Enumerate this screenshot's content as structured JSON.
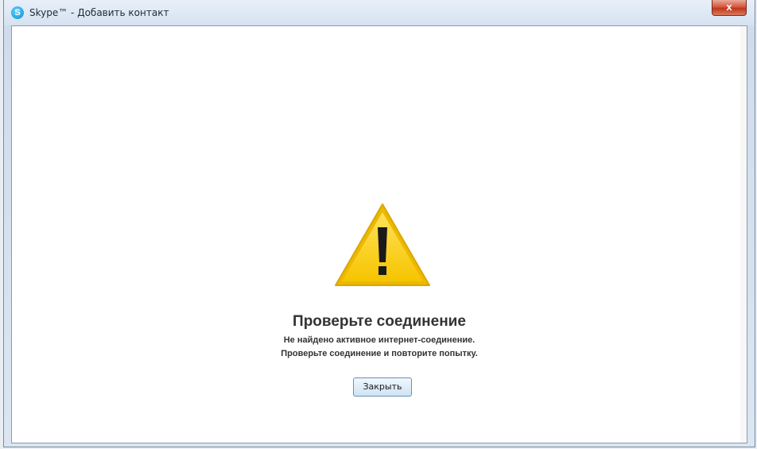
{
  "window": {
    "title": "Skype™ - Добавить контакт",
    "icon": "skype-icon",
    "close_label": "x"
  },
  "message": {
    "icon": "warning-triangle-icon",
    "title": "Проверьте соединение",
    "line1": "Не найдено активное интернет-соединение.",
    "line2": "Проверьте соединение и повторите попытку."
  },
  "actions": {
    "close_label": "Закрыть"
  },
  "colors": {
    "warning_fill": "#ffd21f",
    "warning_border": "#e5b800",
    "close_button": "#c9452a"
  }
}
